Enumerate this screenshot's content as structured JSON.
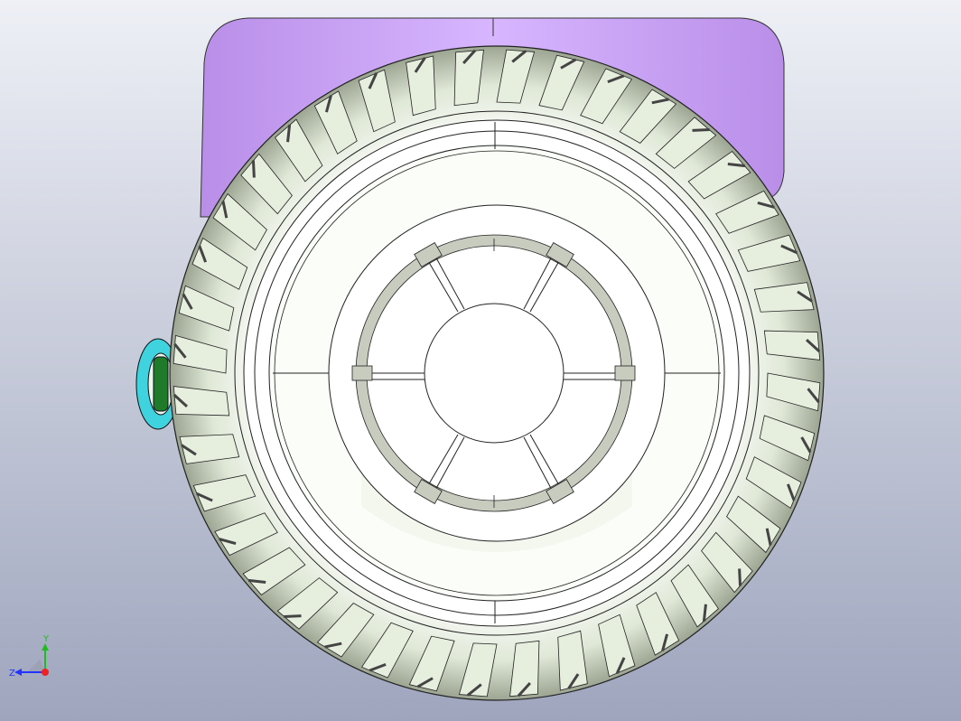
{
  "viewport": {
    "background_top": "#eef0f6",
    "background_bottom": "#9ea5bd"
  },
  "model": {
    "body_color": "#c79af5",
    "tire_color": "#dfe8d6",
    "rim_color": "#ffffff",
    "side_part_colors": [
      "#3fd3df",
      "#1f7a2a"
    ],
    "tread_block_count": 40
  },
  "triad": {
    "y_label": "Y",
    "z_label": "Z",
    "y_color": "#22bb22",
    "z_color": "#2233ff",
    "x_color": "#ee2222"
  }
}
